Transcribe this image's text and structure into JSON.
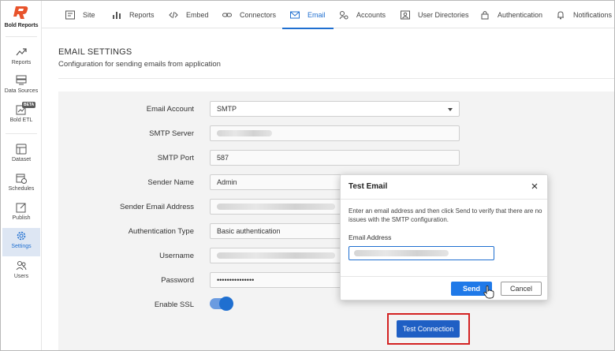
{
  "brand": {
    "name": "Bold Reports",
    "logo_color": "#e8532b"
  },
  "sidebar": {
    "items": [
      {
        "label": "Reports",
        "icon": "trend-icon"
      },
      {
        "label": "Data Sources",
        "icon": "database-icon"
      },
      {
        "label": "Bold ETL",
        "icon": "etl-icon",
        "badge": "BETA"
      },
      {
        "label": "Dataset",
        "icon": "dataset-icon"
      },
      {
        "label": "Schedules",
        "icon": "calendar-clock-icon"
      },
      {
        "label": "Publish",
        "icon": "publish-icon"
      },
      {
        "label": "Settings",
        "icon": "gear-icon",
        "active": true
      },
      {
        "label": "Users",
        "icon": "users-icon"
      }
    ]
  },
  "tabs": [
    {
      "label": "Site",
      "icon": "site-icon"
    },
    {
      "label": "Reports",
      "icon": "bar-chart-icon"
    },
    {
      "label": "Embed",
      "icon": "code-icon"
    },
    {
      "label": "Connectors",
      "icon": "link-icon"
    },
    {
      "label": "Email",
      "icon": "mail-icon",
      "active": true
    },
    {
      "label": "Accounts",
      "icon": "accounts-icon"
    },
    {
      "label": "User Directories",
      "icon": "directory-icon"
    },
    {
      "label": "Authentication",
      "icon": "lock-icon"
    },
    {
      "label": "Notifications",
      "icon": "bell-icon"
    }
  ],
  "page": {
    "title": "EMAIL SETTINGS",
    "subtitle": "Configuration for sending emails from application"
  },
  "form": {
    "email_account": {
      "label": "Email Account",
      "value": "SMTP"
    },
    "smtp_server": {
      "label": "SMTP Server"
    },
    "smtp_port": {
      "label": "SMTP Port",
      "value": "587"
    },
    "sender_name": {
      "label": "Sender Name",
      "value": "Admin"
    },
    "sender_email": {
      "label": "Sender Email Address"
    },
    "auth_type": {
      "label": "Authentication Type",
      "value": "Basic authentication"
    },
    "username": {
      "label": "Username"
    },
    "password": {
      "label": "Password",
      "value": "•••••••••••••••"
    },
    "enable_ssl": {
      "label": "Enable SSL",
      "enabled": true
    },
    "test_button": "Test Connection"
  },
  "modal": {
    "title": "Test Email",
    "description": "Enter an email address and then click Send to verify that there are no issues with the SMTP configuration.",
    "field_label": "Email Address",
    "send": "Send",
    "cancel": "Cancel"
  },
  "colors": {
    "accent": "#1f6fd0",
    "highlight_box": "#d32222",
    "panel_bg": "#f3f3f3"
  }
}
